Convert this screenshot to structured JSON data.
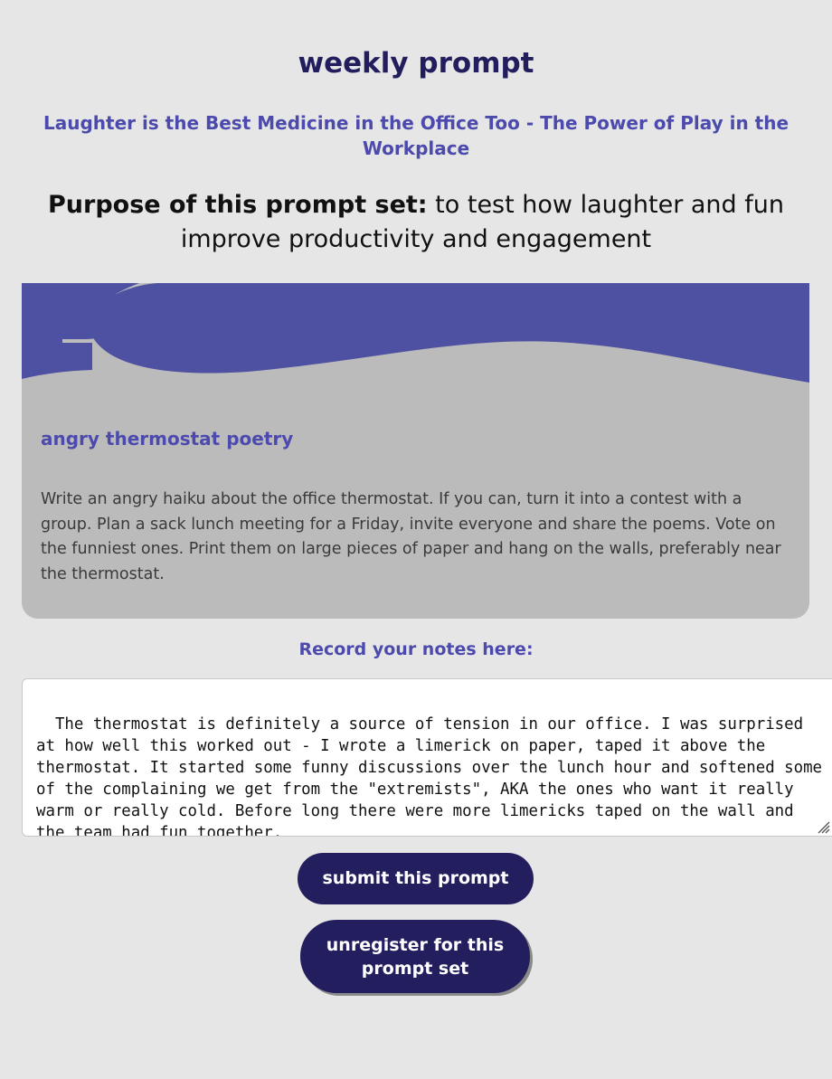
{
  "header": {
    "title": "weekly prompt",
    "set_title": "Laughter is the Best Medicine in the Office Too - The Power of Play in the Workplace",
    "purpose_lead": "Purpose of this prompt set:",
    "purpose_text": " to test how laughter and fun improve productivity and engagement"
  },
  "prompt_card": {
    "heading": "angry thermostat poetry",
    "body": "Write an angry haiku about the office thermostat. If you can, turn it into a contest with a group. Plan a sack lunch meeting for a Friday, invite everyone and share the poems. Vote on the funniest ones. Print them on large pieces of paper and hang on the walls, preferably near the thermostat.",
    "wave_color": "#4e50a1"
  },
  "notes": {
    "label": "Record your notes here:",
    "value": "The thermostat is definitely a source of tension in our office. I was surprised at how well this worked out - I wrote a limerick on paper, taped it above the thermostat. It started some funny discussions over the lunch hour and softened some of the complaining we get from the \"extremists\", AKA the ones who want it really warm or really cold. Before long there were more limericks taped on the wall and the team had fun together."
  },
  "actions": {
    "submit_label": "submit this prompt",
    "unregister_label": "unregister for this prompt set"
  },
  "colors": {
    "background": "#e6e6e6",
    "accent": "#4c4aad",
    "button": "#231e5e",
    "card": "#bbbbbb"
  }
}
